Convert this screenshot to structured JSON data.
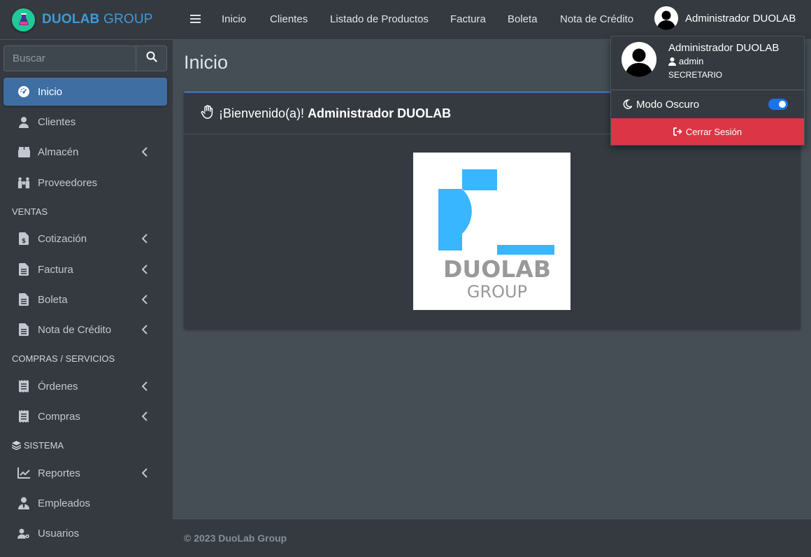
{
  "brand": {
    "name_bold": "DUOLAB",
    "name_light": "GROUP"
  },
  "search": {
    "placeholder": "Buscar"
  },
  "sidebar": {
    "items": [
      {
        "label": "Inicio",
        "icon": "dashboard-icon",
        "active": true
      },
      {
        "label": "Clientes",
        "icon": "user-icon"
      },
      {
        "label": "Almacén",
        "icon": "box-icon",
        "submenu": true
      },
      {
        "label": "Proveedores",
        "icon": "people-carry-icon"
      },
      {
        "label": "Cotización",
        "icon": "invoice-dollar-icon",
        "submenu": true
      },
      {
        "label": "Factura",
        "icon": "file-alt-icon",
        "submenu": true
      },
      {
        "label": "Boleta",
        "icon": "file-alt-icon",
        "submenu": true
      },
      {
        "label": "Nota de Crédito",
        "icon": "file-alt-icon",
        "submenu": true
      },
      {
        "label": "Órdenes",
        "icon": "receipt-icon",
        "submenu": true
      },
      {
        "label": "Compras",
        "icon": "receipt-icon",
        "submenu": true
      },
      {
        "label": "Reportes",
        "icon": "chart-line-icon",
        "submenu": true
      },
      {
        "label": "Empleados",
        "icon": "user-tie-icon"
      },
      {
        "label": "Usuarios",
        "icon": "user-cog-icon"
      }
    ],
    "headers": [
      "VENTAS",
      "COMPRAS / SERVICIOS",
      "SISTEMA"
    ]
  },
  "topnav": {
    "links": [
      "Inicio",
      "Clientes",
      "Listado de Productos",
      "Factura",
      "Boleta",
      "Nota de Crédito"
    ],
    "user_name": "Administrador DUOLAB"
  },
  "main": {
    "title": "Inicio",
    "welcome_prefix": "¡Bienvenido(a)!",
    "welcome_name": "Administrador DUOLAB",
    "logo_text_1": "DUOLAB",
    "logo_text_2": "GROUP"
  },
  "footer": {
    "text": "© 2023 DuoLab Group"
  },
  "user_menu": {
    "name": "Administrador DUOLAB",
    "login": "admin",
    "role": "SECRETARIO",
    "dark_mode_label": "Modo Oscuro",
    "dark_mode_on": true,
    "logout_label": "Cerrar Sesión"
  },
  "colors": {
    "accent": "#3f6ea3",
    "brand": "#3f9ad8",
    "danger": "#dc3545",
    "toggle": "#1a73e8",
    "logo_blue": "#38b6ff"
  }
}
